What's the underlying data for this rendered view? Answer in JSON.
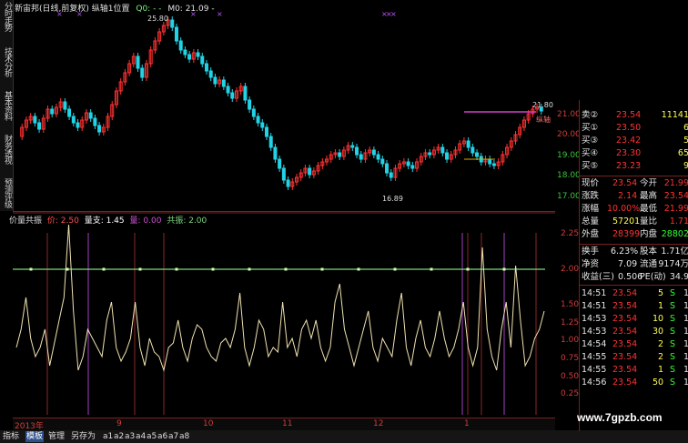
{
  "left_tabs": [
    "分时走势",
    "技术分析",
    "基本资料",
    "财务透视",
    "预测评级"
  ],
  "main_title": {
    "stock": "新宙邦(日线,前复权)",
    "mode": "纵轴1位置",
    "q0": "Q0: - -",
    "m0": "M0: 21.09 -"
  },
  "main_axis": [
    "21.00",
    "20.00",
    "19.00",
    "18.00",
    "17.00"
  ],
  "price_marks": {
    "high": "25.80",
    "low": "16.89",
    "current": "21.80"
  },
  "chart_legend_tag": "纵轴",
  "indicator_title": {
    "name": "价量共振",
    "price": "价: 2.50",
    "vol": "量支: 1.45",
    "amount": "量: 0.00",
    "resonance": "共振: 2.00"
  },
  "indicator_axis": [
    "2.25",
    "2.00",
    "1.75",
    "1.50",
    "1.25",
    "1.00",
    "0.75",
    "0.50",
    "0.25"
  ],
  "date_labels": [
    "2013年",
    "9",
    "10",
    "11",
    "12",
    "1"
  ],
  "bottom_tabs": [
    "指标",
    "模板",
    "管理",
    "另存为",
    "a1",
    "a2",
    "a3",
    "a4",
    "a5",
    "a6",
    "a7",
    "a8"
  ],
  "quote": {
    "asks": [
      {
        "label": "卖②",
        "price": "23.54",
        "vol": "11141"
      },
      {
        "label": "买①",
        "price": "23.50",
        "vol": "6"
      },
      {
        "label": "买③",
        "price": "23.42",
        "vol": "5"
      },
      {
        "label": "买④",
        "price": "23.30",
        "vol": "65"
      },
      {
        "label": "买⑤",
        "price": "23.23",
        "vol": "9"
      }
    ],
    "stats": [
      {
        "l1": "现价",
        "v1": "23.54",
        "l2": "今开",
        "v2": "21.99"
      },
      {
        "l1": "涨跌",
        "v1": "2.14",
        "l2": "最高",
        "v2": "23.54"
      },
      {
        "l1": "涨幅",
        "v1": "10.00%",
        "l2": "最低",
        "v2": "21.99"
      },
      {
        "l1": "总量",
        "v1": "57201",
        "l2": "量比",
        "v2": "1.71"
      },
      {
        "l1": "外盘",
        "v1": "28399",
        "l2": "内盘",
        "v2": "28802"
      }
    ],
    "extra": [
      {
        "l1": "换手",
        "v1": "6.23%",
        "l2": "股本",
        "v2": "1.71亿"
      },
      {
        "l1": "净资",
        "v1": "7.09",
        "l2": "流通",
        "v2": "9174万"
      },
      {
        "l1": "收益(三)",
        "v1": "0.506",
        "l2": "PE(动)",
        "v2": "34.9"
      }
    ],
    "ticks": [
      {
        "time": "14:51",
        "price": "23.54",
        "vol": "5",
        "side": "S",
        "n": "1"
      },
      {
        "time": "14:51",
        "price": "23.54",
        "vol": "1",
        "side": "S",
        "n": "1"
      },
      {
        "time": "14:53",
        "price": "23.54",
        "vol": "10",
        "side": "S",
        "n": "1"
      },
      {
        "time": "14:53",
        "price": "23.54",
        "vol": "30",
        "side": "S",
        "n": "1"
      },
      {
        "time": "14:54",
        "price": "23.54",
        "vol": "2",
        "side": "S",
        "n": "1"
      },
      {
        "time": "14:55",
        "price": "23.54",
        "vol": "2",
        "side": "S",
        "n": "1"
      },
      {
        "time": "14:55",
        "price": "23.54",
        "vol": "1",
        "side": "S",
        "n": "1"
      },
      {
        "time": "14:56",
        "price": "23.54",
        "vol": "50",
        "side": "S",
        "n": "1"
      }
    ]
  },
  "watermark": "www.7gpzb.com",
  "colors": {
    "up": "#ff3232",
    "down": "#22d3e6",
    "grid_red": "#7a1f1f",
    "res_line": "#7fd67f"
  }
}
